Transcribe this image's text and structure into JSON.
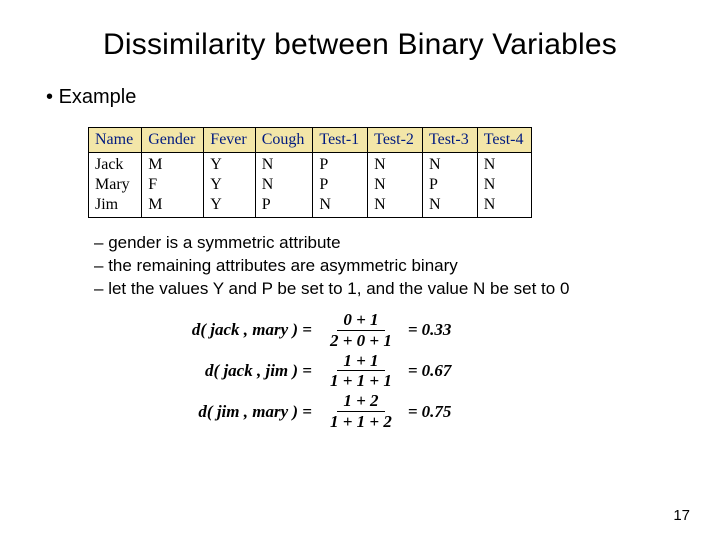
{
  "title": "Dissimilarity between Binary Variables",
  "bullet": "Example",
  "table": {
    "headers": [
      "Name",
      "Gender",
      "Fever",
      "Cough",
      "Test-1",
      "Test-2",
      "Test-3",
      "Test-4"
    ],
    "rows": [
      [
        "Jack",
        "M",
        "Y",
        "N",
        "P",
        "N",
        "N",
        "N"
      ],
      [
        "Mary",
        "F",
        "Y",
        "N",
        "P",
        "N",
        "P",
        "N"
      ],
      [
        "Jim",
        "M",
        "Y",
        "P",
        "N",
        "N",
        "N",
        "N"
      ]
    ]
  },
  "notes": [
    "gender is a symmetric attribute",
    "the remaining attributes are asymmetric binary",
    "let the values Y and P be set to 1, and the value N be set to 0"
  ],
  "formulas": [
    {
      "lhs": "d( jack , mary ) =",
      "num": "0 + 1",
      "den": "2 + 0 + 1",
      "result": "0.33"
    },
    {
      "lhs": "d( jack , jim ) =",
      "num": "1 + 1",
      "den": "1 + 1 + 1",
      "result": "0.67"
    },
    {
      "lhs": "d( jim , mary ) =",
      "num": "1 + 2",
      "den": "1 + 1 + 2",
      "result": "0.75"
    }
  ],
  "page_number": "17"
}
